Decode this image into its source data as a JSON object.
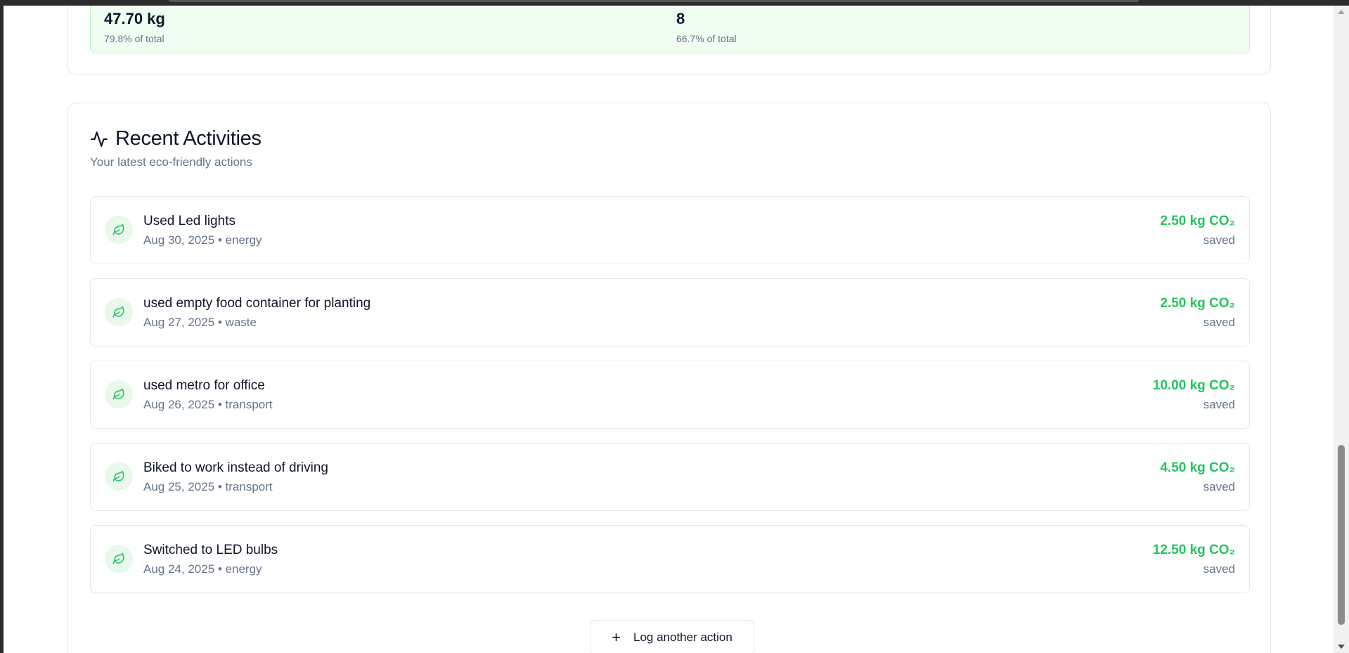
{
  "summary": {
    "left_stat": {
      "value": "47.70 kg",
      "sub": "79.8% of total"
    },
    "right_stat": {
      "value": "8",
      "sub": "66.7% of total"
    }
  },
  "activities": {
    "title": "Recent Activities",
    "subtitle": "Your latest eco-friendly actions",
    "header_icon": "activity-pulse-icon",
    "item_icon": "leaf-icon",
    "accent_color": "#22c55e",
    "items": [
      {
        "title": "Used Led lights",
        "meta": "Aug 30, 2025 • energy",
        "amount": "2.50 kg CO₂",
        "saved": "saved"
      },
      {
        "title": "used empty food container for planting",
        "meta": "Aug 27, 2025 • waste",
        "amount": "2.50 kg CO₂",
        "saved": "saved"
      },
      {
        "title": "used metro for office",
        "meta": "Aug 26, 2025 • transport",
        "amount": "10.00 kg CO₂",
        "saved": "saved"
      },
      {
        "title": "Biked to work instead of driving",
        "meta": "Aug 25, 2025 • transport",
        "amount": "4.50 kg CO₂",
        "saved": "saved"
      },
      {
        "title": "Switched to LED bulbs",
        "meta": "Aug 24, 2025 • energy",
        "amount": "12.50 kg CO₂",
        "saved": "saved"
      }
    ],
    "log_button": {
      "icon": "plus-icon",
      "label": "Log another action"
    }
  }
}
